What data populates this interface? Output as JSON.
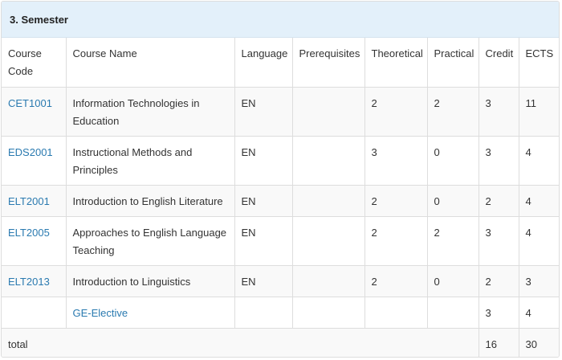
{
  "semester": {
    "title": "3. Semester"
  },
  "table": {
    "headers": {
      "code": "Course Code",
      "name": "Course Name",
      "language": "Language",
      "prerequisites": "Prerequisites",
      "theoretical": "Theoretical",
      "practical": "Practical",
      "credit": "Credit",
      "ects": "ECTS"
    },
    "rows": [
      {
        "code": "CET1001",
        "name": "Information Technologies in Education",
        "language": "EN",
        "prerequisites": "",
        "theoretical": "2",
        "practical": "2",
        "credit": "3",
        "ects": "11"
      },
      {
        "code": "EDS2001",
        "name": "Instructional Methods and Principles",
        "language": "EN",
        "prerequisites": "",
        "theoretical": "3",
        "practical": "0",
        "credit": "3",
        "ects": "4"
      },
      {
        "code": "ELT2001",
        "name": "Introduction to English Literature",
        "language": "EN",
        "prerequisites": "",
        "theoretical": "2",
        "practical": "0",
        "credit": "2",
        "ects": "4"
      },
      {
        "code": "ELT2005",
        "name": "Approaches to English Language Teaching",
        "language": "EN",
        "prerequisites": "",
        "theoretical": "2",
        "practical": "2",
        "credit": "3",
        "ects": "4"
      },
      {
        "code": "ELT2013",
        "name": "Introduction to Linguistics",
        "language": "EN",
        "prerequisites": "",
        "theoretical": "2",
        "practical": "0",
        "credit": "2",
        "ects": "3"
      },
      {
        "code": "",
        "name": "GE-Elective",
        "language": "",
        "prerequisites": "",
        "theoretical": "",
        "practical": "",
        "credit": "3",
        "ects": "4"
      }
    ],
    "total": {
      "label": "total",
      "credit": "16",
      "ects": "30"
    }
  },
  "colors": {
    "heading_bg": "#e3f0fa",
    "link": "#2a7ab0",
    "row_shade": "#f9f9f9",
    "border": "#dddddd"
  }
}
